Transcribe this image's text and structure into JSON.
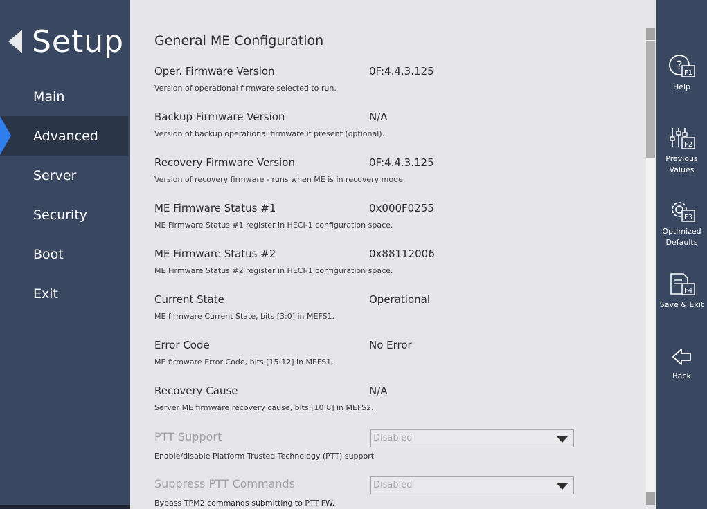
{
  "header": {
    "title": "Setup"
  },
  "nav": {
    "items": [
      {
        "label": "Main"
      },
      {
        "label": "Advanced"
      },
      {
        "label": "Server"
      },
      {
        "label": "Security"
      },
      {
        "label": "Boot"
      },
      {
        "label": "Exit"
      }
    ],
    "active": "Advanced"
  },
  "main": {
    "title": "General ME Configuration",
    "rows": [
      {
        "label": "Oper. Firmware Version",
        "value": "0F:4.4.3.125",
        "desc": "Version of operational firmware selected to run."
      },
      {
        "label": "Backup Firmware Version",
        "value": "N/A",
        "desc": "Version of backup operational firmware if present (optional)."
      },
      {
        "label": "Recovery Firmware Version",
        "value": "0F:4.4.3.125",
        "desc": "Version of recovery firmware - runs when ME is in recovery mode."
      },
      {
        "label": "ME Firmware Status #1",
        "value": "0x000F0255",
        "desc": "ME Firmware Status #1 register in HECI-1 configuration space."
      },
      {
        "label": "ME Firmware Status #2",
        "value": "0x88112006",
        "desc": "ME Firmware Status #2 register in HECI-1 configuration space."
      },
      {
        "label": "Current State",
        "value": "Operational",
        "desc": "ME firmware Current State, bits [3:0] in MEFS1."
      },
      {
        "label": "Error Code",
        "value": "No Error",
        "desc": "ME firmware Error Code, bits [15:12] in MEFS1."
      },
      {
        "label": "Recovery Cause",
        "value": "N/A",
        "desc": "Server ME firmware recovery cause, bits [10:8] in MEFS2."
      }
    ],
    "selects": [
      {
        "label": "PTT Support",
        "value": "Disabled",
        "desc": "Enable/disable Platform Trusted Technology (PTT) support"
      },
      {
        "label": "Suppress PTT Commands",
        "value": "Disabled",
        "desc": "Bypass TPM2 commands submitting to PTT FW."
      }
    ]
  },
  "actions": {
    "help": {
      "label": "Help",
      "key": "F1"
    },
    "previous": {
      "label_line1": "Previous",
      "label_line2": "Values",
      "key": "F2"
    },
    "optimized": {
      "label_line1": "Optimized",
      "label_line2": "Defaults",
      "key": "F3"
    },
    "save_exit": {
      "label": "Save & Exit",
      "key": "F4"
    },
    "back": {
      "label": "Back"
    }
  },
  "colors": {
    "sidebar_bg": "#394760",
    "active_bg": "#2b3548",
    "accent": "#2f7dee",
    "content_bg": "#e6e5e8"
  }
}
